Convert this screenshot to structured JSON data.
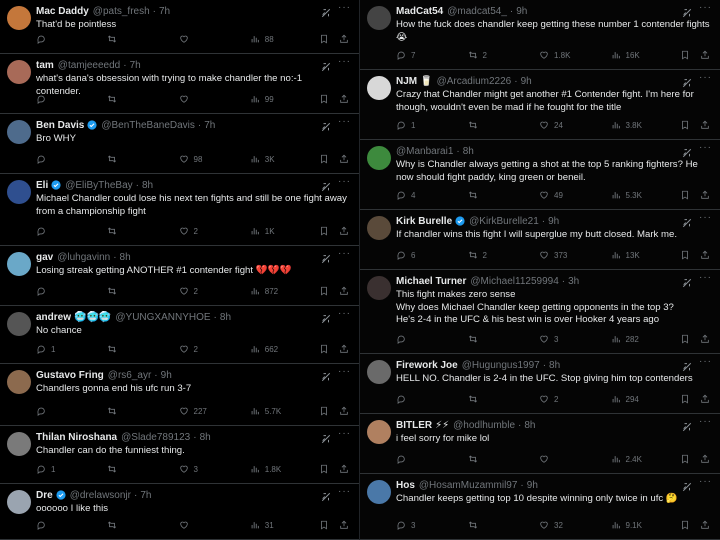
{
  "left": [
    {
      "name": "Mac Daddy",
      "handle": "@pats_fresh",
      "time": "7h",
      "text": "That'd be pointless",
      "replies": "",
      "retweets": "",
      "likes": "",
      "views": "88",
      "verified": false,
      "emoji": "",
      "avatar": "#c4773b"
    },
    {
      "name": "tam",
      "handle": "@tamjeeeedd",
      "time": "7h",
      "text": "what's dana's obsession with trying to make chandler the no:-1 contender.",
      "replies": "",
      "retweets": "",
      "likes": "",
      "views": "99",
      "verified": false,
      "emoji": "",
      "avatar": "#a86a58"
    },
    {
      "name": "Ben Davis",
      "handle": "@BenTheBaneDavis",
      "time": "7h",
      "text": "Bro WHY",
      "replies": "",
      "retweets": "",
      "likes": "98",
      "views": "3K",
      "verified": true,
      "emoji": "",
      "avatar": "#4e6b8c"
    },
    {
      "name": "Eli",
      "handle": "@EliByTheBay",
      "time": "8h",
      "text": "Michael Chandler could lose his next ten fights and still be one fight away from a championship fight",
      "replies": "",
      "retweets": "",
      "likes": "2",
      "views": "1K",
      "verified": true,
      "emoji": "",
      "avatar": "#2f4f8f"
    },
    {
      "name": "gav",
      "handle": "@luhgavinn",
      "time": "8h",
      "text": "Losing streak getting ANOTHER #1 contender fight 💔💔💔",
      "replies": "",
      "retweets": "",
      "likes": "2",
      "views": "872",
      "verified": false,
      "emoji": "",
      "avatar": "#6aa8c8"
    },
    {
      "name": "andrew",
      "handle": "@YUNGXANNYHOE",
      "time": "8h",
      "text": "No chance",
      "replies": "1",
      "retweets": "",
      "likes": "2",
      "views": "662",
      "verified": false,
      "emoji": "🥶🥶🥶",
      "avatar": "#555555"
    },
    {
      "name": "Gustavo Fring",
      "handle": "@rs6_ayr",
      "time": "9h",
      "text": "Chandlers gonna end his ufc run 3-7",
      "replies": "",
      "retweets": "",
      "likes": "227",
      "views": "5.7K",
      "verified": false,
      "emoji": "",
      "avatar": "#8c6a4e"
    },
    {
      "name": "Thilan Niroshana",
      "handle": "@Slade789123",
      "time": "8h",
      "text": "Chandler can do the funniest thing.",
      "replies": "1",
      "retweets": "",
      "likes": "3",
      "views": "1.8K",
      "verified": false,
      "emoji": "",
      "avatar": "#7a7a7a"
    },
    {
      "name": "Dre",
      "handle": "@drelawsonjr",
      "time": "7h",
      "text": "oooooo I like this",
      "replies": "",
      "retweets": "",
      "likes": "",
      "views": "31",
      "verified": true,
      "emoji": "",
      "avatar": "#9aa4b0"
    }
  ],
  "right": [
    {
      "name": "MadCat54",
      "handle": "@madcat54_",
      "time": "9h",
      "text": "How the fuck does chandler keep getting these number 1 contender fights 😭",
      "replies": "7",
      "retweets": "2",
      "likes": "1.8K",
      "views": "16K",
      "verified": false,
      "emoji": "",
      "avatar": "#444444"
    },
    {
      "name": "NJM",
      "handle": "@Arcadium2226",
      "time": "9h",
      "text": "Crazy that Chandler might get another #1 Contender fight. I'm here for though, wouldn't even be mad if he fought for the title",
      "replies": "1",
      "retweets": "",
      "likes": "24",
      "views": "3.8K",
      "verified": false,
      "emoji": "🥛",
      "avatar": "#d8d8d8"
    },
    {
      "name": "",
      "handle": "@Manbarai1",
      "time": "8h",
      "text": "Why is Chandler always getting a shot at the top 5 ranking fighters? He now should fight paddy, king green or beneil.",
      "replies": "4",
      "retweets": "",
      "likes": "49",
      "views": "5.3K",
      "verified": false,
      "emoji": "",
      "avatar": "#3d8a3d"
    },
    {
      "name": "Kirk Burelle",
      "handle": "@KirkBurelle21",
      "time": "9h",
      "text": "If chandler wins this fight I will superglue my butt closed.  Mark me.",
      "replies": "6",
      "retweets": "2",
      "likes": "373",
      "views": "13K",
      "verified": true,
      "emoji": "",
      "avatar": "#5a4a3a"
    },
    {
      "name": "Michael Turner",
      "handle": "@Michael11259994",
      "time": "3h",
      "text": "This fight makes zero sense\nWhy does Michael Chandler keep getting opponents in the top 3?\n He's 2-4 in the UFC & his best win is over Hooker 4 years ago",
      "replies": "",
      "retweets": "",
      "likes": "3",
      "views": "282",
      "verified": false,
      "emoji": "",
      "avatar": "#3a3030"
    },
    {
      "name": "Firework Joe",
      "handle": "@Hugungus1997",
      "time": "8h",
      "text": "HELL NO. Chandler is 2-4 in the UFC. Stop giving him top contenders",
      "replies": "",
      "retweets": "",
      "likes": "2",
      "views": "294",
      "verified": false,
      "emoji": "",
      "avatar": "#6a6a6a"
    },
    {
      "name": "BITLER",
      "handle": "@hodlhumble",
      "time": "8h",
      "text": "i feel sorry for mike lol",
      "replies": "",
      "retweets": "",
      "likes": "",
      "views": "2.4K",
      "verified": false,
      "emoji": "⚡⚡",
      "avatar": "#b08060"
    },
    {
      "name": "Hos",
      "handle": "@HosamMuzammil97",
      "time": "9h",
      "text": "Chandler keeps getting top 10 despite winning only twice in ufc 🤔",
      "replies": "3",
      "retweets": "",
      "likes": "32",
      "views": "9.1K",
      "verified": false,
      "emoji": "",
      "avatar": "#4a78a8"
    }
  ],
  "colors": {
    "bg": "#000000",
    "text": "#e7e9ea",
    "muted": "#71767b",
    "verified": "#1d9bf0",
    "border": "#2f3336"
  }
}
